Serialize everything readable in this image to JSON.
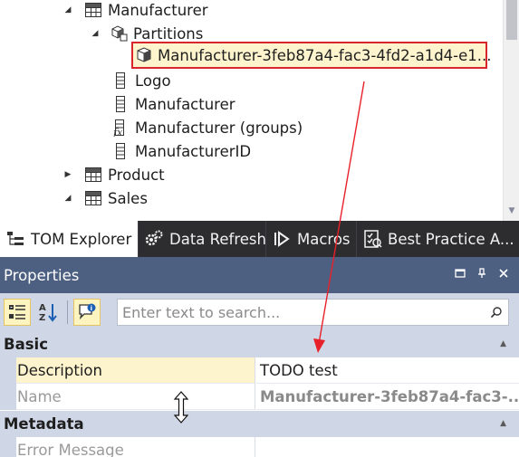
{
  "tree": {
    "items": [
      {
        "label": "Manufacturer",
        "icon": "table-icon",
        "expander": "expanded"
      },
      {
        "label": "Partitions",
        "icon": "partitions-icon",
        "expander": "expanded"
      },
      {
        "label": "Manufacturer-3feb87a4-fac3-4fd2-a1d4-e1...",
        "icon": "partition-icon",
        "expander": "none",
        "selected": true
      },
      {
        "label": "Logo",
        "icon": "column-icon",
        "expander": "none"
      },
      {
        "label": "Manufacturer",
        "icon": "column-icon",
        "expander": "none"
      },
      {
        "label": "Manufacturer (groups)",
        "icon": "calculated-column-icon",
        "expander": "none"
      },
      {
        "label": "ManufacturerID",
        "icon": "column-icon",
        "expander": "none"
      },
      {
        "label": "Product",
        "icon": "table-icon",
        "expander": "collapsed"
      },
      {
        "label": "Sales",
        "icon": "table-icon",
        "expander": "expanded"
      }
    ]
  },
  "tabs": [
    {
      "label": "TOM Explorer",
      "icon": "tree-icon",
      "active": true
    },
    {
      "label": "Data Refresh",
      "icon": "gears-icon",
      "active": false
    },
    {
      "label": "Macros",
      "icon": "macro-play-icon",
      "active": false
    },
    {
      "label": "Best Practice A...",
      "icon": "checklist-icon",
      "active": false
    }
  ],
  "properties": {
    "title": "Properties",
    "header_buttons": [
      "window-menu",
      "pin",
      "close"
    ],
    "search": {
      "placeholder": "Enter text to search...",
      "value": ""
    },
    "categories": [
      {
        "label": "Basic",
        "rows": [
          {
            "name": "Description",
            "value": "TODO test",
            "selected": true,
            "readonly": false
          },
          {
            "name": "Name",
            "value": "Manufacturer-3feb87a4-fac3-...",
            "selected": false,
            "readonly": true
          }
        ]
      },
      {
        "label": "Metadata",
        "rows": [
          {
            "name": "Error Message",
            "value": "",
            "selected": false,
            "readonly": true
          }
        ]
      }
    ]
  },
  "colors": {
    "accent_header": "#4d6082",
    "toolbar_bg": "#cfd6e5",
    "selection_bg": "#fdf4ce",
    "highlight_border": "#d9262b",
    "tab_strip_bg": "#2d2d30"
  }
}
